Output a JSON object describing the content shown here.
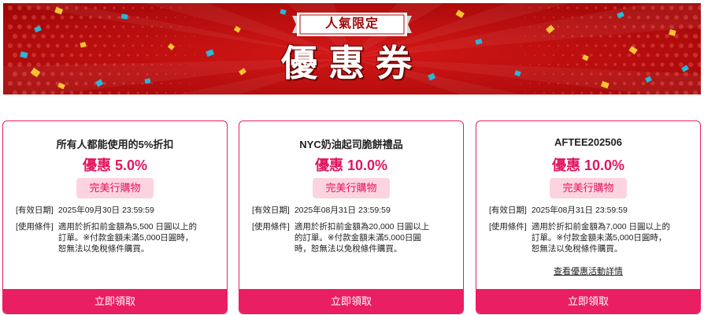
{
  "banner": {
    "ribbon_text": "人氣限定",
    "title": "優惠券"
  },
  "colors": {
    "accent": "#e91e63",
    "banner_red": "#c41111",
    "tag_bg": "#fcd4df"
  },
  "coupons": [
    {
      "title": "所有人都能使用的5%折扣",
      "discount": "優惠 5.0%",
      "tag": "完美行購物",
      "expiry_label": "[有效日期]",
      "expiry_value": "2025年09月30日 23:59:59",
      "condition_label": "[使用條件]",
      "condition_lines": [
        "適用於折扣前金額為5,500 日圓以上的",
        "訂單。※付款金額未滿5,000日圓時，",
        "恕無法以免稅條件購買。"
      ],
      "button": "立即領取"
    },
    {
      "title": "NYC奶油起司脆餅禮品",
      "discount": "優惠 10.0%",
      "tag": "完美行購物",
      "expiry_label": "[有效日期]",
      "expiry_value": "2025年08月31日 23:59:59",
      "condition_label": "[使用條件]",
      "condition_lines": [
        "適用於折扣前金額為20,000 日圓以上",
        "的訂單。※付款金額未滿5,000日圓",
        "時，恕無法以免稅條件購買。"
      ],
      "button": "立即領取"
    },
    {
      "title": "AFTEE202506",
      "discount": "優惠 10.0%",
      "tag": "完美行購物",
      "expiry_label": "[有效日期]",
      "expiry_value": "2025年08月31日 23:59:59",
      "condition_label": "[使用條件]",
      "condition_lines": [
        "適用於折扣前金額為7,000 日圓以上的",
        "訂單。※付款金額未滿5,000日圓時，",
        "恕無法以免稅條件購買。"
      ],
      "detail_link": "查看優惠活動詳情",
      "button": "立即領取"
    }
  ]
}
